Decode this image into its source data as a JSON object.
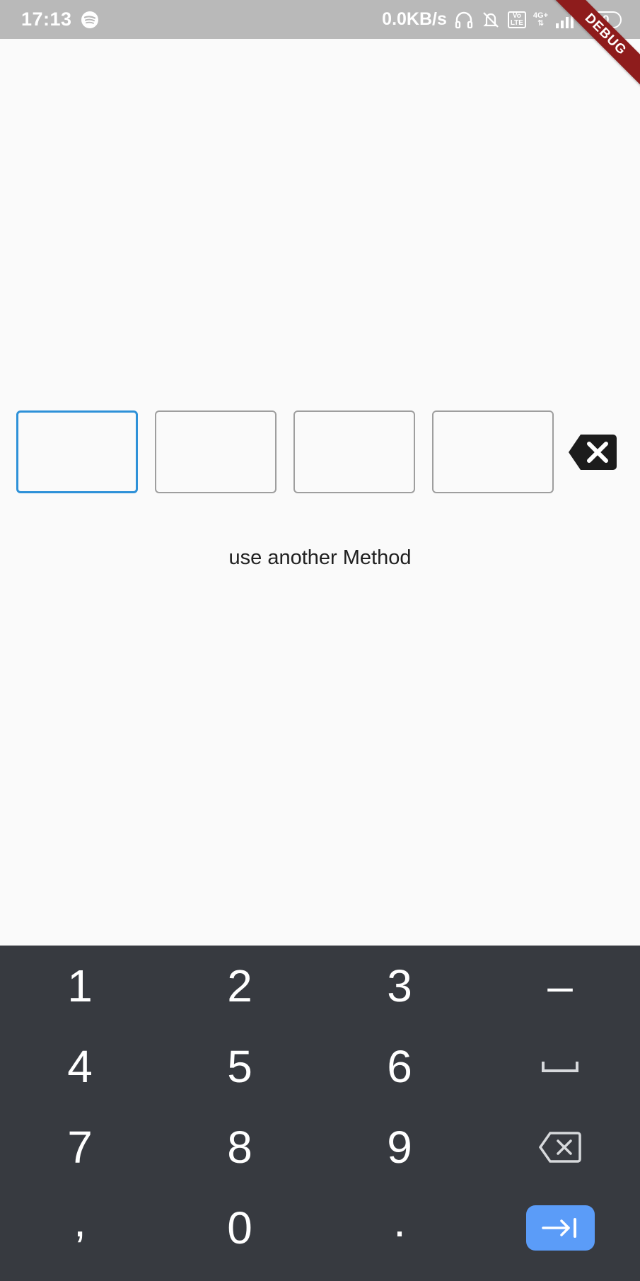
{
  "status_bar": {
    "time": "17:13",
    "net_speed": "0.0KB/s",
    "volte_line1": "Vo",
    "volte_line2": "LTE",
    "network_type": "4G+",
    "battery_level": "60",
    "icons": [
      "spotify-icon",
      "headset-icon",
      "bell-off-icon",
      "volte-icon",
      "signal-icon",
      "battery-icon"
    ]
  },
  "debug_banner": "DEBUG",
  "pin_entry": {
    "box_count": 4,
    "active_index": 0,
    "active_color": "#2e91d8",
    "inactive_color": "#9e9e9e",
    "clear_icon": "backspace-icon"
  },
  "alt_method_text": "use another Method",
  "keyboard": {
    "background": "#373a40",
    "rows": [
      [
        "1",
        "2",
        "3",
        "–"
      ],
      [
        "4",
        "5",
        "6",
        "space"
      ],
      [
        "7",
        "8",
        "9",
        "backspace"
      ],
      [
        ",",
        "0",
        ".",
        "next"
      ]
    ],
    "enter_color": "#5b9cf8"
  }
}
